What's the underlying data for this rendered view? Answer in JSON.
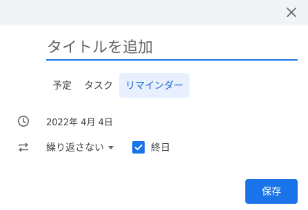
{
  "dialog": {
    "close_icon": "close-icon",
    "title_placeholder": "タイトルを追加",
    "title_value": ""
  },
  "tabs": [
    {
      "label": "予定",
      "active": false
    },
    {
      "label": "タスク",
      "active": false
    },
    {
      "label": "リマインダー",
      "active": true
    }
  ],
  "date": {
    "icon": "clock-icon",
    "text": "2022年 4月 4日"
  },
  "repeat": {
    "icon": "repeat-icon",
    "selected": "繰り返さない"
  },
  "all_day": {
    "label": "終日",
    "checked": true
  },
  "actions": {
    "save_label": "保存"
  },
  "colors": {
    "accent": "#1a73e8",
    "active_tab_bg": "#e8f0fe",
    "active_tab_text": "#1967d2",
    "header_bg": "#f1f3f4"
  }
}
